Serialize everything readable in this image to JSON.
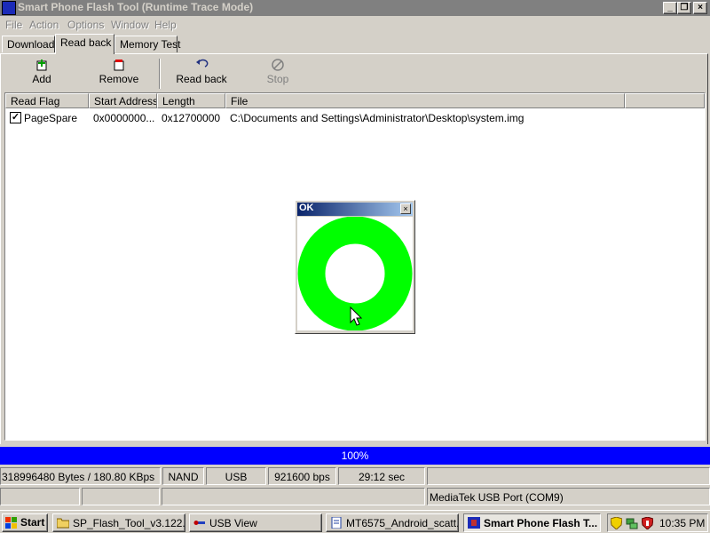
{
  "window": {
    "title": "Smart Phone Flash Tool (Runtime Trace Mode)",
    "caption_buttons": {
      "minimize": "_",
      "restore": "❐",
      "close": "×"
    }
  },
  "menu": [
    "File",
    "Action",
    "Options",
    "Window",
    "Help"
  ],
  "tabs": [
    "Download",
    "Read back",
    "Memory Test"
  ],
  "active_tab": "Read back",
  "toolbar": {
    "add_label": "Add",
    "remove_label": "Remove",
    "readback_label": "Read back",
    "stop_label": "Stop"
  },
  "table": {
    "columns": [
      "Read Flag",
      "Start Address",
      "Length",
      "File"
    ],
    "rows": [
      {
        "checked": true,
        "read_flag": "PageSpare",
        "start_address": "0x0000000...",
        "length": "0x12700000",
        "file": "C:\\Documents and Settings\\Administrator\\Desktop\\system.img"
      }
    ]
  },
  "dialog": {
    "title": "OK",
    "close": "×",
    "ring_color": "#00ff00"
  },
  "progress": {
    "text": "100%",
    "value": 1.0,
    "color": "#0000ff"
  },
  "status": {
    "bytes": "318996480 Bytes / 180.80 KBps",
    "storage": "NAND",
    "connection": "USB",
    "baud": "921600 bps",
    "time": "29:12 sec",
    "port": "MediaTek USB Port (COM9)"
  },
  "taskbar": {
    "start": "Start",
    "tasks": [
      {
        "label": "SP_Flash_Tool_v3.122...",
        "icon": "folder-icon"
      },
      {
        "label": "USB View",
        "icon": "usb-icon"
      },
      {
        "label": "MT6575_Android_scatt...",
        "icon": "document-icon"
      },
      {
        "label": "Smart Phone Flash T...",
        "icon": "flash-tool-icon",
        "active": true
      }
    ],
    "clock": "10:35 PM"
  }
}
